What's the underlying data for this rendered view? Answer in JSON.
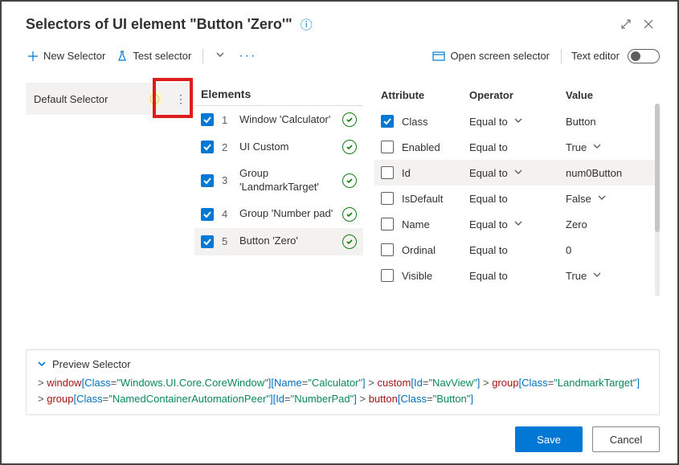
{
  "header": {
    "title": "Selectors of UI element \"Button 'Zero'\""
  },
  "toolbar": {
    "new_selector": "New Selector",
    "test_selector": "Test selector",
    "open_screen_selector": "Open screen selector",
    "text_editor": "Text editor"
  },
  "sidebar": {
    "selectors": [
      {
        "label": "Default Selector"
      }
    ]
  },
  "elements_title": "Elements",
  "elements": [
    {
      "index": "1",
      "label": "Window 'Calculator'"
    },
    {
      "index": "2",
      "label": "UI Custom"
    },
    {
      "index": "3",
      "label": "Group 'LandmarkTarget'"
    },
    {
      "index": "4",
      "label": "Group 'Number pad'"
    },
    {
      "index": "5",
      "label": "Button 'Zero'"
    }
  ],
  "attr_head": {
    "attribute": "Attribute",
    "operator": "Operator",
    "value": "Value"
  },
  "attributes": [
    {
      "checked": true,
      "name": "Class",
      "op": "Equal to",
      "op_chev": true,
      "value": "Button",
      "val_chev": false
    },
    {
      "checked": false,
      "name": "Enabled",
      "op": "Equal to",
      "op_chev": false,
      "value": "True",
      "val_chev": true
    },
    {
      "checked": false,
      "name": "Id",
      "op": "Equal to",
      "op_chev": true,
      "value": "num0Button",
      "val_chev": false,
      "active": true
    },
    {
      "checked": false,
      "name": "IsDefault",
      "op": "Equal to",
      "op_chev": false,
      "value": "False",
      "val_chev": true
    },
    {
      "checked": false,
      "name": "Name",
      "op": "Equal to",
      "op_chev": true,
      "value": "Zero",
      "val_chev": false
    },
    {
      "checked": false,
      "name": "Ordinal",
      "op": "Equal to",
      "op_chev": false,
      "value": "0",
      "val_chev": false
    },
    {
      "checked": false,
      "name": "Visible",
      "op": "Equal to",
      "op_chev": false,
      "value": "True",
      "val_chev": true
    }
  ],
  "preview": {
    "title": "Preview Selector",
    "tokens": [
      {
        "t": "gt",
        "v": "> "
      },
      {
        "t": "el",
        "v": "window"
      },
      {
        "t": "br",
        "v": "["
      },
      {
        "t": "attr",
        "v": "Class"
      },
      {
        "t": "eq",
        "v": "="
      },
      {
        "t": "val",
        "v": "\"Windows.UI.Core.CoreWindow\""
      },
      {
        "t": "br",
        "v": "]"
      },
      {
        "t": "br",
        "v": "["
      },
      {
        "t": "attr",
        "v": "Name"
      },
      {
        "t": "eq",
        "v": "="
      },
      {
        "t": "val",
        "v": "\"Calculator\""
      },
      {
        "t": "br",
        "v": "]"
      },
      {
        "t": "gt",
        "v": " > "
      },
      {
        "t": "el",
        "v": "custom"
      },
      {
        "t": "br",
        "v": "["
      },
      {
        "t": "attr",
        "v": "Id"
      },
      {
        "t": "eq",
        "v": "="
      },
      {
        "t": "val",
        "v": "\"NavView\""
      },
      {
        "t": "br",
        "v": "]"
      },
      {
        "t": "gt",
        "v": " > "
      },
      {
        "t": "el",
        "v": "group"
      },
      {
        "t": "br",
        "v": "["
      },
      {
        "t": "attr",
        "v": "Class"
      },
      {
        "t": "eq",
        "v": "="
      },
      {
        "t": "val",
        "v": "\"LandmarkTarget\""
      },
      {
        "t": "br",
        "v": "]"
      },
      {
        "t": "brk",
        "v": ""
      },
      {
        "t": "gt",
        "v": "> "
      },
      {
        "t": "el",
        "v": "group"
      },
      {
        "t": "br",
        "v": "["
      },
      {
        "t": "attr",
        "v": "Class"
      },
      {
        "t": "eq",
        "v": "="
      },
      {
        "t": "val",
        "v": "\"NamedContainerAutomationPeer\""
      },
      {
        "t": "br",
        "v": "]"
      },
      {
        "t": "br",
        "v": "["
      },
      {
        "t": "attr",
        "v": "Id"
      },
      {
        "t": "eq",
        "v": "="
      },
      {
        "t": "val",
        "v": "\"NumberPad\""
      },
      {
        "t": "br",
        "v": "]"
      },
      {
        "t": "gt",
        "v": " > "
      },
      {
        "t": "el",
        "v": "button"
      },
      {
        "t": "br",
        "v": "["
      },
      {
        "t": "attr",
        "v": "Class"
      },
      {
        "t": "eq",
        "v": "="
      },
      {
        "t": "val",
        "v": "\"Button\""
      },
      {
        "t": "br",
        "v": "]"
      }
    ]
  },
  "footer": {
    "save": "Save",
    "cancel": "Cancel"
  }
}
